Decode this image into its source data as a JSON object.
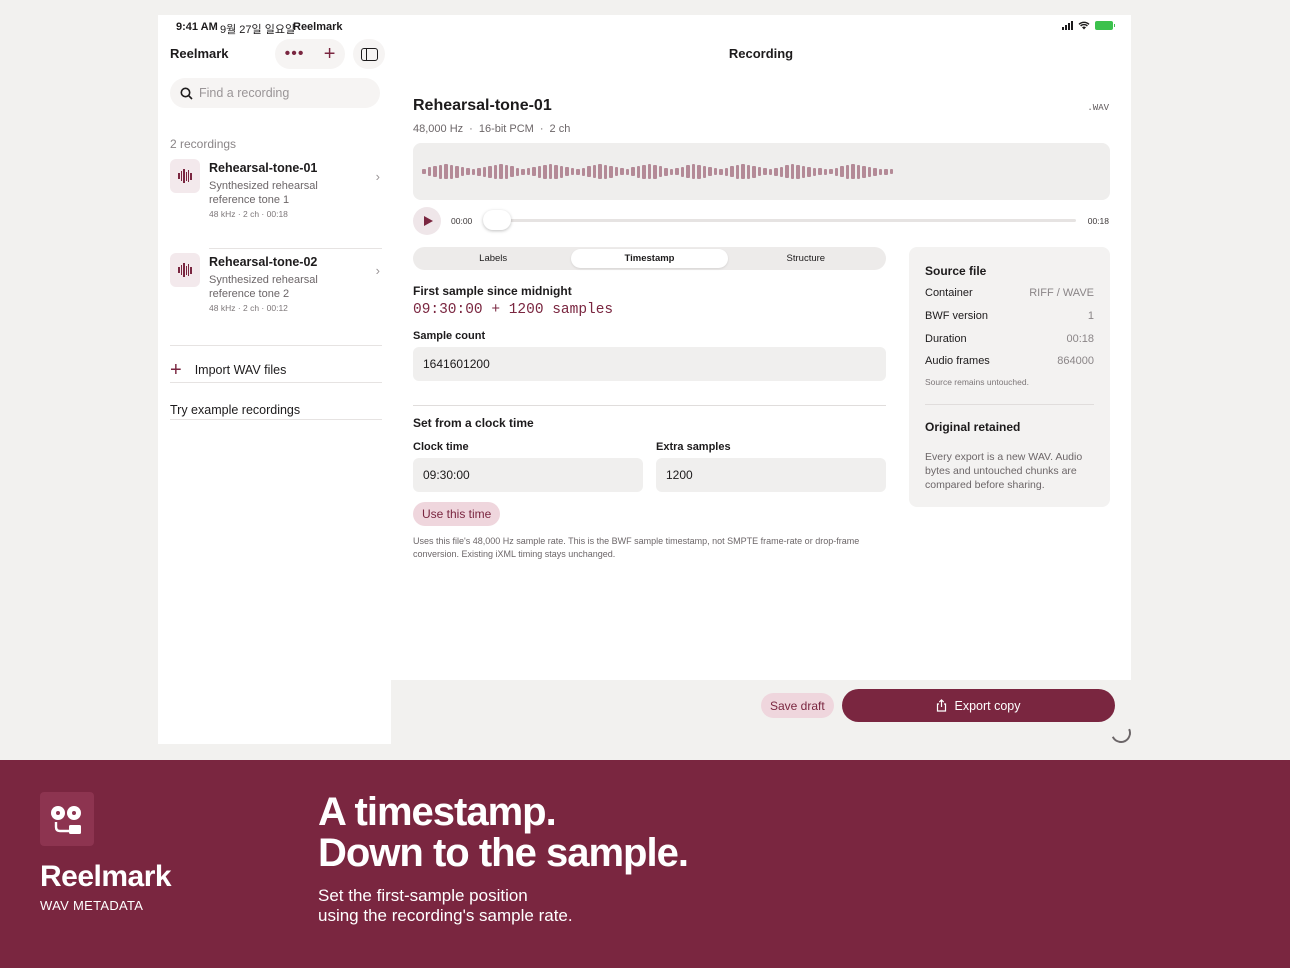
{
  "status_bar": {
    "time": "9:41 AM",
    "date": "9월 27일 일요일",
    "app": "Reelmark"
  },
  "sidebar": {
    "title": "Reelmark",
    "search_placeholder": "Find a recording",
    "count_label": "2 recordings",
    "recordings": [
      {
        "name": "Rehearsal-tone-01",
        "description": "Synthesized rehearsal reference tone 1",
        "meta": "48 kHz · 2 ch · 00:18"
      },
      {
        "name": "Rehearsal-tone-02",
        "description": "Synthesized rehearsal reference tone 2",
        "meta": "48 kHz · 2 ch · 00:12"
      }
    ],
    "import_label": "Import WAV files",
    "example_label": "Try example recordings"
  },
  "main": {
    "nav_title": "Recording",
    "recording": {
      "title": "Rehearsal-tone-01",
      "extension": ".WAV",
      "sample_rate": "48,000 Hz",
      "bit_depth": "16-bit PCM",
      "channels": "2 ch"
    },
    "player": {
      "position": "00:00",
      "duration": "00:18",
      "progress": 0
    },
    "tabs": [
      "Labels",
      "Timestamp",
      "Structure"
    ],
    "active_tab": "Timestamp",
    "timestamp": {
      "first_sample_heading": "First sample since midnight",
      "first_sample_value": "09:30:00 + 1200 samples",
      "sample_count_label": "Sample count",
      "sample_count_value": "1641601200",
      "set_clock_heading": "Set from a clock time",
      "clock_time_label": "Clock time",
      "clock_time_value": "09:30:00",
      "extra_samples_label": "Extra samples",
      "extra_samples_value": "1200",
      "use_button": "Use this time",
      "note": "Uses this file's 48,000 Hz sample rate. This is the BWF sample timestamp, not SMPTE frame-rate or drop-frame conversion. Existing iXML timing stays unchanged."
    },
    "source_file": {
      "heading": "Source file",
      "rows": [
        {
          "key": "Container",
          "value": "RIFF / WAVE"
        },
        {
          "key": "BWF version",
          "value": "1"
        },
        {
          "key": "Duration",
          "value": "00:18"
        },
        {
          "key": "Audio frames",
          "value": "864000"
        }
      ],
      "note": "Source remains untouched.",
      "retained_heading": "Original retained",
      "retained_text": "Every export is a new WAV. Audio bytes and untouched chunks are compared before sharing."
    },
    "footer": {
      "save_draft": "Save draft",
      "export": "Export copy"
    }
  },
  "promo": {
    "brand": "Reelmark",
    "brand_sub": "WAV METADATA",
    "headline_1": "A timestamp.",
    "headline_2": "Down to the sample.",
    "tagline_1": "Set the first-sample position",
    "tagline_2": "using the recording's sample rate."
  },
  "colors": {
    "accent": "#7a2640",
    "accent_soft": "#efd6dd",
    "wave": "#b48a97",
    "promo_bg": "#7a2640"
  },
  "waveform_levels": [
    0.25,
    0.45,
    0.55,
    0.7,
    0.75,
    0.7,
    0.6,
    0.45,
    0.35,
    0.3,
    0.4,
    0.5,
    0.6,
    0.7,
    0.75,
    0.7,
    0.55,
    0.4,
    0.3,
    0.35,
    0.45,
    0.6,
    0.7,
    0.75,
    0.7,
    0.6,
    0.45,
    0.35,
    0.3,
    0.4,
    0.55,
    0.65,
    0.75,
    0.7,
    0.6,
    0.45,
    0.35,
    0.3,
    0.45,
    0.6,
    0.7,
    0.75,
    0.7,
    0.55,
    0.4,
    0.3,
    0.35,
    0.5,
    0.65,
    0.75,
    0.7,
    0.6,
    0.45,
    0.35,
    0.3,
    0.4,
    0.55,
    0.7,
    0.75,
    0.7,
    0.6,
    0.45,
    0.35,
    0.3,
    0.4,
    0.5,
    0.65,
    0.75,
    0.7,
    0.6,
    0.5,
    0.4,
    0.35,
    0.3,
    0.25,
    0.4,
    0.55,
    0.7,
    0.75,
    0.7,
    0.6,
    0.5,
    0.4,
    0.3,
    0.3,
    0.25
  ]
}
